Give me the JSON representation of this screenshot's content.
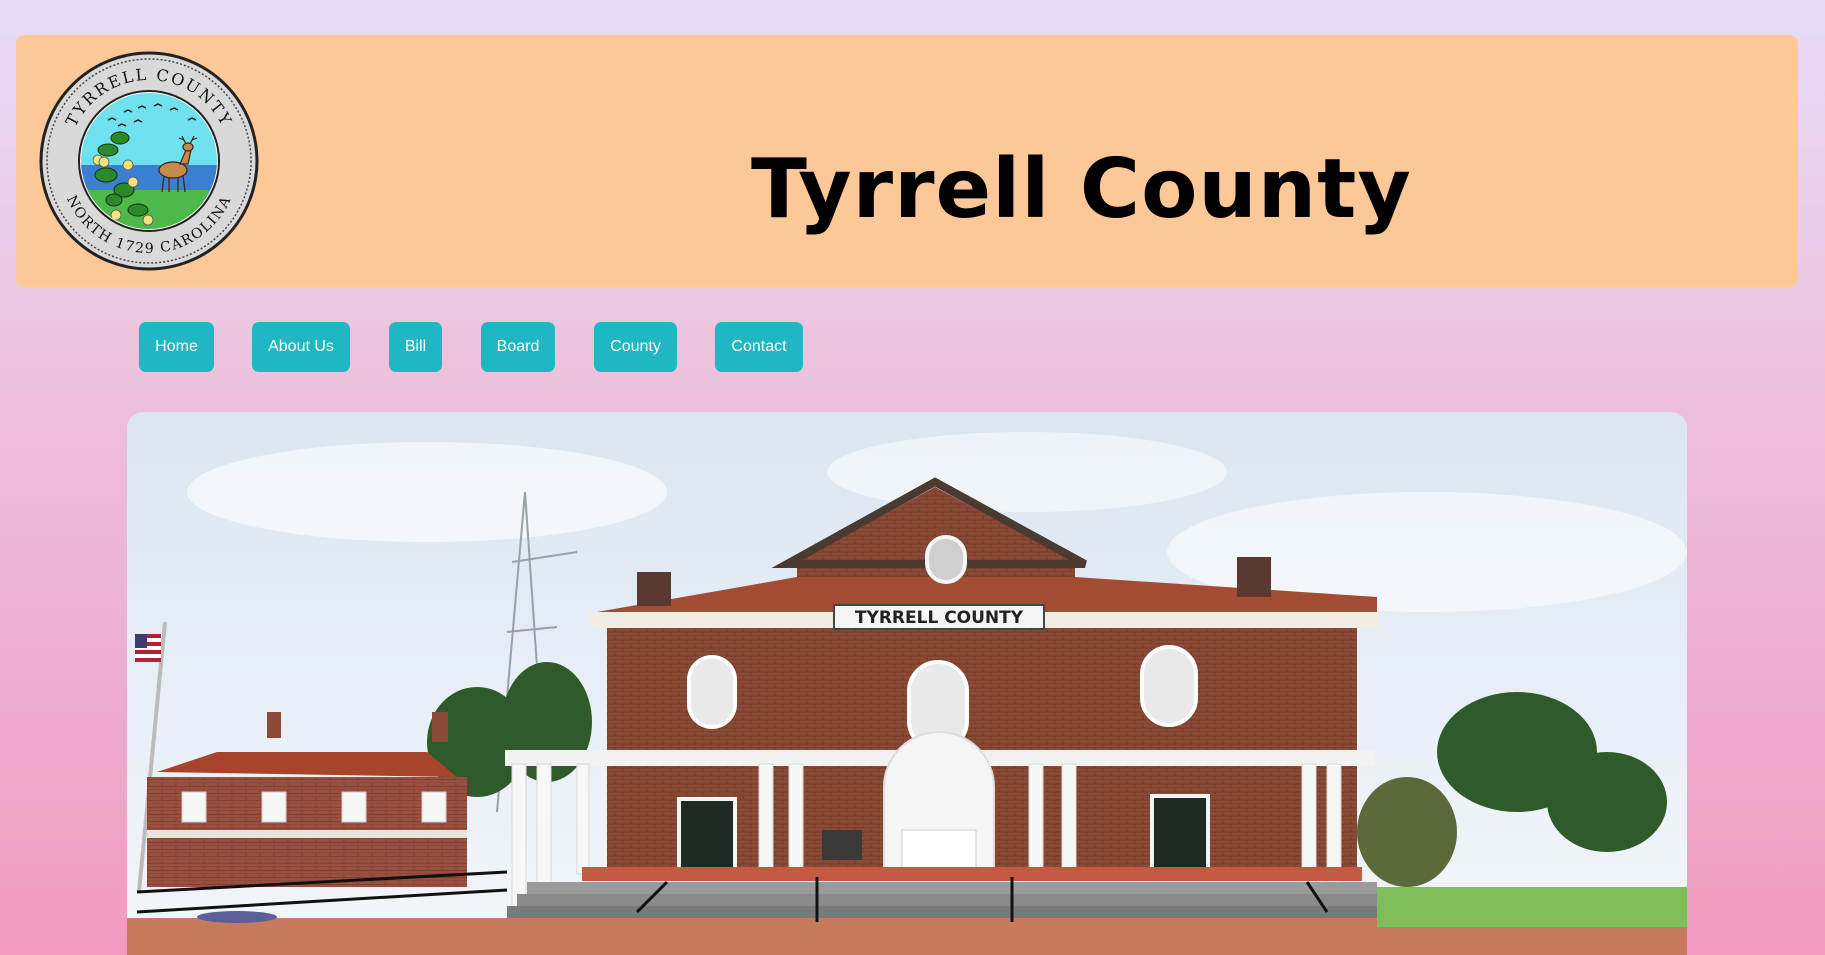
{
  "header": {
    "title": "Tyrrell County",
    "seal": {
      "top_text": "TYRRELL COUNTY",
      "bottom_text": "NORTH 1729 CAROLINA"
    }
  },
  "nav": {
    "items": [
      {
        "label": "Home"
      },
      {
        "label": "About Us"
      },
      {
        "label": "Bill"
      },
      {
        "label": "Board"
      },
      {
        "label": "County"
      },
      {
        "label": "Contact"
      }
    ]
  },
  "hero": {
    "sign_text": "TYRRELL COUNTY"
  },
  "colors": {
    "header_bg": "#fdc898",
    "nav_button": "#1fb7c1",
    "nav_text": "#ffffff",
    "page_gradient_top": "#e6dcf8",
    "page_gradient_bottom": "#f09bbf"
  },
  "icons": [
    "county-seal-logo",
    "courthouse-photo",
    "us-flag"
  ]
}
